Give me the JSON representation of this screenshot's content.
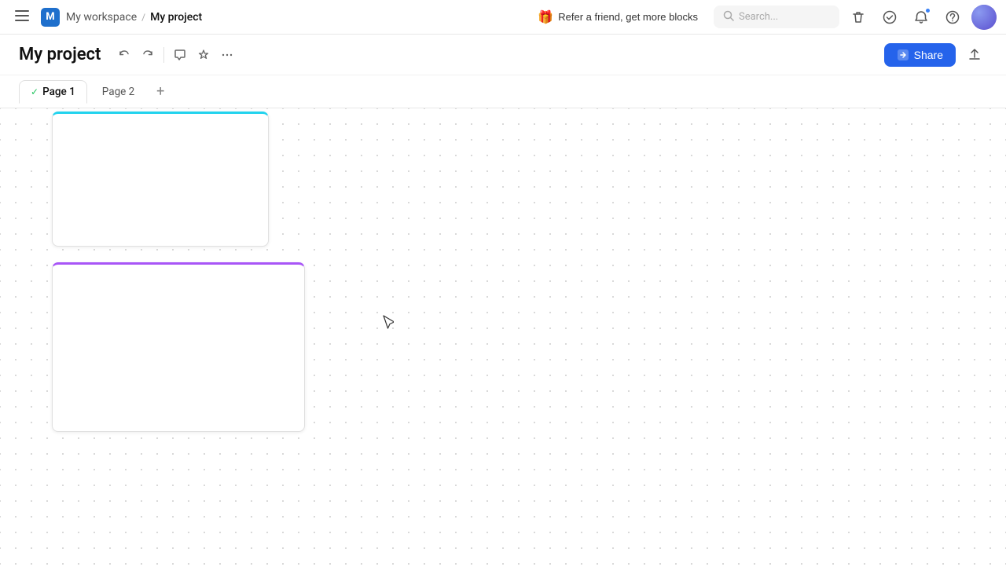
{
  "nav": {
    "menu_icon": "☰",
    "workspace_logo": "M",
    "workspace_name": "My workspace",
    "breadcrumb_sep": "/",
    "project_name": "My project",
    "refer_label": "Refer a friend, get more blocks",
    "search_placeholder": "Search...",
    "icons": {
      "trash": "🗑",
      "check_circle": "✓",
      "bell": "🔔",
      "help": "?"
    }
  },
  "toolbar": {
    "title": "My project",
    "undo_icon": "↺",
    "redo_icon": "↻",
    "comment_icon": "💬",
    "star_icon": "☆",
    "more_icon": "···",
    "share_label": "Share",
    "export_icon": "↑"
  },
  "tabs": [
    {
      "id": "page1",
      "label": "Page 1",
      "active": true,
      "check": true
    },
    {
      "id": "page2",
      "label": "Page 2",
      "active": false,
      "check": false
    }
  ],
  "canvas": {
    "cards": [
      {
        "id": "card1",
        "border_color": "#22d3ee"
      },
      {
        "id": "card2",
        "border_color": "#a855f7"
      }
    ]
  },
  "colors": {
    "share_btn": "#2563eb",
    "tab_active_check": "#22c55e"
  }
}
